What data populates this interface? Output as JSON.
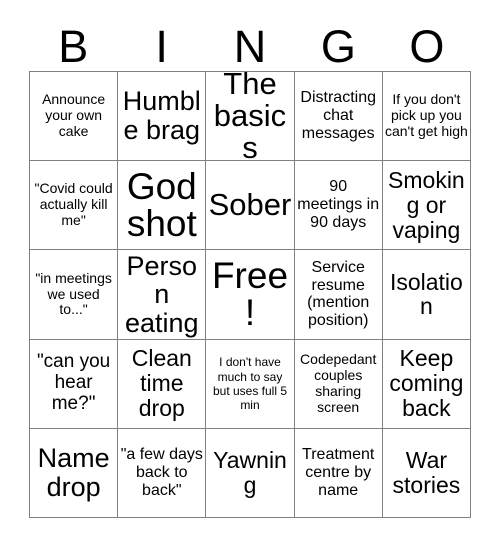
{
  "card": {
    "title": "BINGO",
    "header_letters": [
      "B",
      "I",
      "N",
      "G",
      "O"
    ],
    "border_color": "#808080",
    "text_color": "#000000",
    "background_color": "#ffffff",
    "rows": 5,
    "columns": 5,
    "cells": [
      {
        "text": "Announce your own cake",
        "size": "sm",
        "marked": false
      },
      {
        "text": "Humble brag",
        "size": "2xl",
        "marked": false
      },
      {
        "text": "The basics",
        "size": "3xl",
        "marked": false
      },
      {
        "text": "Distracting chat messages",
        "size": "md",
        "marked": false
      },
      {
        "text": "If you don't pick up you can't get high",
        "size": "sm",
        "marked": false
      },
      {
        "text": "\"Covid could actually kill me\"",
        "size": "sm",
        "marked": false
      },
      {
        "text": "God shot",
        "size": "4xl",
        "marked": false
      },
      {
        "text": "Sober",
        "size": "3xl",
        "marked": false
      },
      {
        "text": "90 meetings in 90 days",
        "size": "md",
        "marked": false
      },
      {
        "text": "Smoking or vaping",
        "size": "xl",
        "marked": false
      },
      {
        "text": "\"in meetings we used to...\"",
        "size": "sm",
        "marked": false
      },
      {
        "text": "Person eating",
        "size": "2xl",
        "marked": false
      },
      {
        "text": "Free!",
        "size": "4xl",
        "marked": false,
        "free_space": true
      },
      {
        "text": "Service resume (mention position)",
        "size": "md",
        "marked": false
      },
      {
        "text": "Isolation",
        "size": "xl",
        "marked": false
      },
      {
        "text": "\"can you hear me?\"",
        "size": "lg",
        "marked": false
      },
      {
        "text": "Clean time drop",
        "size": "xl",
        "marked": false
      },
      {
        "text": "I don't have much to say but uses full 5 min",
        "size": "xs",
        "marked": false
      },
      {
        "text": "Codepedant couples sharing screen",
        "size": "sm",
        "marked": false
      },
      {
        "text": "Keep coming back",
        "size": "xl",
        "marked": false
      },
      {
        "text": "Name drop",
        "size": "2xl",
        "marked": false
      },
      {
        "text": "\"a few days back to back\"",
        "size": "md",
        "marked": false
      },
      {
        "text": "Yawning",
        "size": "xl",
        "marked": false
      },
      {
        "text": "Treatment centre by name",
        "size": "md",
        "marked": false
      },
      {
        "text": "War stories",
        "size": "xl",
        "marked": false
      }
    ]
  }
}
